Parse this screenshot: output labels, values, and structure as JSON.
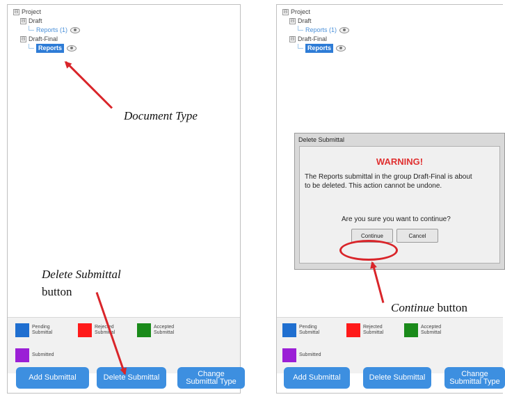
{
  "tree": {
    "root": "Project",
    "group1": "Draft",
    "group1_child": "Reports (1)",
    "group2": "Draft-Final",
    "group2_child": "Reports",
    "expand_glyph": "⊟"
  },
  "legend": {
    "pending": {
      "label": "Pending Submittal",
      "color": "#1f6fd0"
    },
    "rejected": {
      "label": "Rejected Submittal",
      "color": "#ff1a1a"
    },
    "accepted": {
      "label": "Accepted Submittal",
      "color": "#1a8a1a"
    },
    "submitted": {
      "label": "Submitted",
      "color": "#9b1fd6"
    }
  },
  "buttons": {
    "add": "Add Submittal",
    "delete": "Delete Submittal",
    "change": "Change Submittal Type"
  },
  "annotations": {
    "document_type": "Document Type",
    "delete_italic": "Delete Submittal",
    "delete_rest": "button",
    "continue_italic": "Continue",
    "continue_rest": "button"
  },
  "dialog": {
    "title": "Delete Submittal",
    "warning": "WARNING!",
    "message": "The Reports submittal in the group Draft-Final is about to be deleted.  This action cannot be undone.",
    "question": "Are you sure you want to continue?",
    "continue": "Continue",
    "cancel": "Cancel"
  },
  "colors": {
    "accent": "#3d8fe0",
    "annotation_red": "#d9252a",
    "warning": "#e03030"
  }
}
